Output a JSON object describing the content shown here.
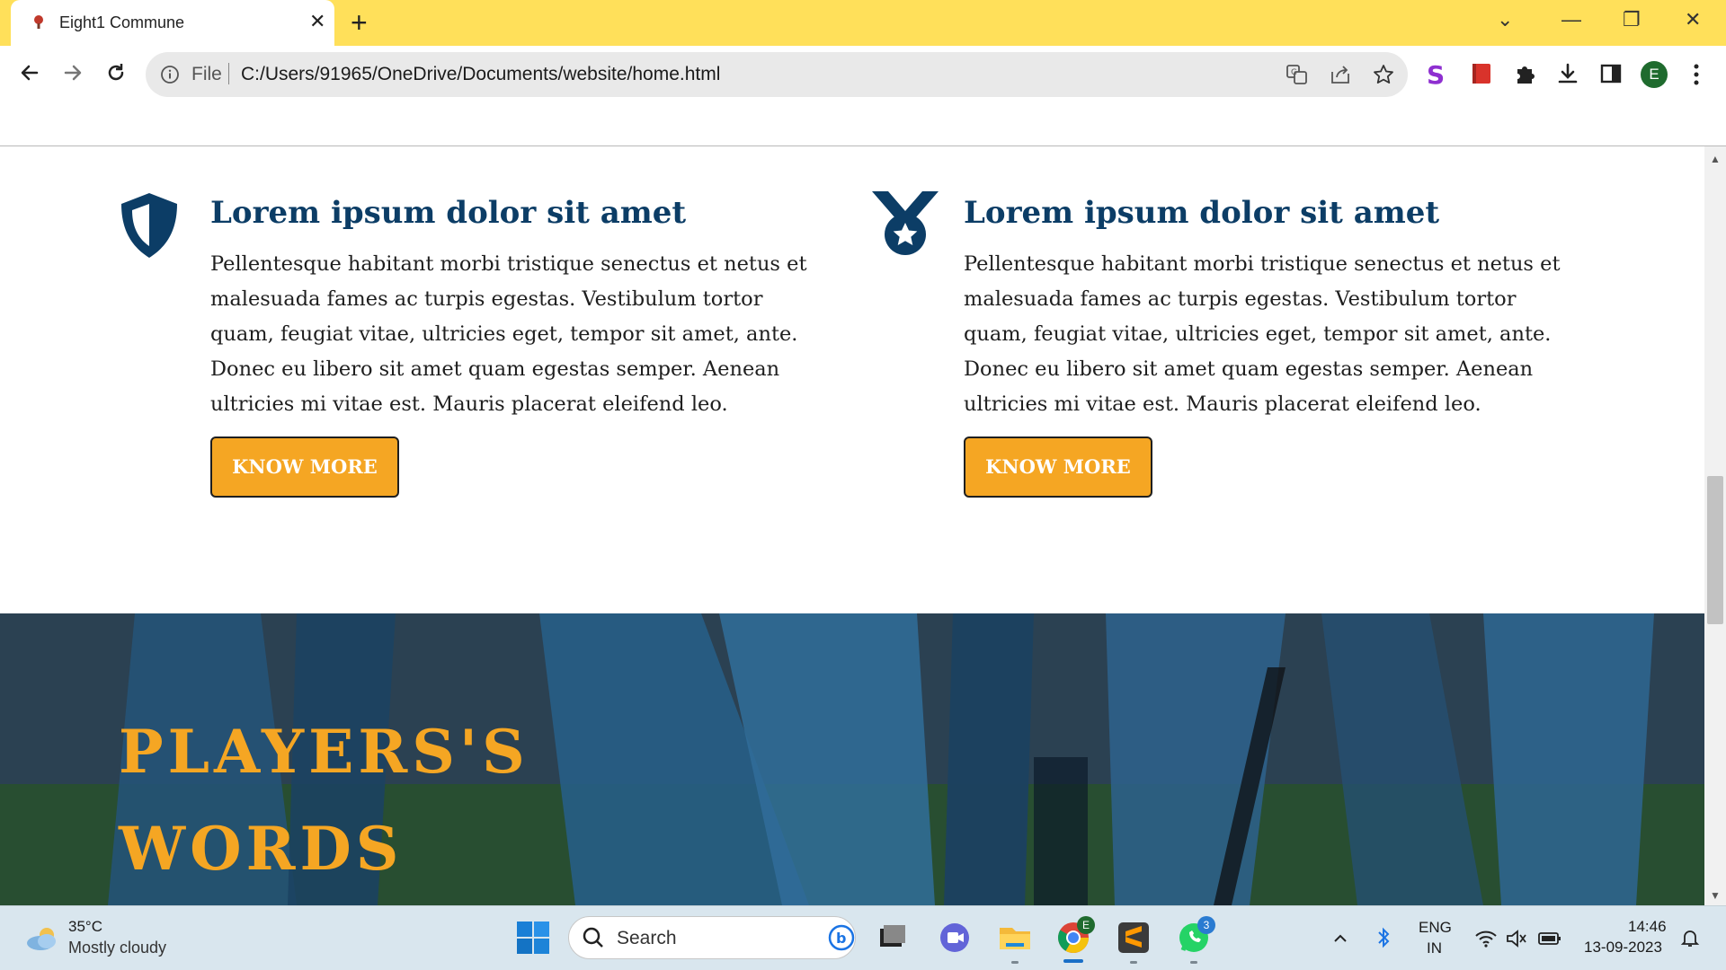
{
  "browser": {
    "tab_title": "Eight1 Commune",
    "tab_close": "✕",
    "new_tab": "+",
    "url_scheme_label": "File",
    "url": "C:/Users/91965/OneDrive/Documents/website/home.html",
    "profile_initial": "E",
    "window_controls": {
      "minimize": "—",
      "restore": "❐",
      "close": "✕",
      "tab_search": "⌄"
    }
  },
  "features": [
    {
      "icon": "shield-icon",
      "title": "Lorem ipsum dolor sit amet",
      "text": "Pellentesque habitant morbi tristique senectus et netus et malesuada fames ac turpis egestas. Vestibulum tortor quam, feugiat vitae, ultricies eget, tempor sit amet, ante. Donec eu libero sit amet quam egestas semper. Aenean ultricies mi vitae est. Mauris placerat eleifend leo.",
      "button": "KNOW MORE"
    },
    {
      "icon": "medal-icon",
      "title": "Lorem ipsum dolor sit amet",
      "text": "Pellentesque habitant morbi tristique senectus et netus et malesuada fames ac turpis egestas. Vestibulum tortor quam, feugiat vitae, ultricies eget, tempor sit amet, ante. Donec eu libero sit amet quam egestas semper. Aenean ultricies mi vitae est. Mauris placerat eleifend leo.",
      "button": "KNOW MORE"
    }
  ],
  "hero": {
    "title_line1": "PLAYERS'S",
    "title_line2": "WORDS"
  },
  "taskbar": {
    "weather_temp": "35°C",
    "weather_desc": "Mostly cloudy",
    "search_label": "Search",
    "chrome_badge": "E",
    "whatsapp_badge": "3",
    "lang_top": "ENG",
    "lang_bottom": "IN",
    "time": "14:46",
    "date": "13-09-2023"
  },
  "colors": {
    "tab_strip": "#ffe05a",
    "heading_navy": "#0c3d66",
    "accent_orange": "#f5a623"
  }
}
